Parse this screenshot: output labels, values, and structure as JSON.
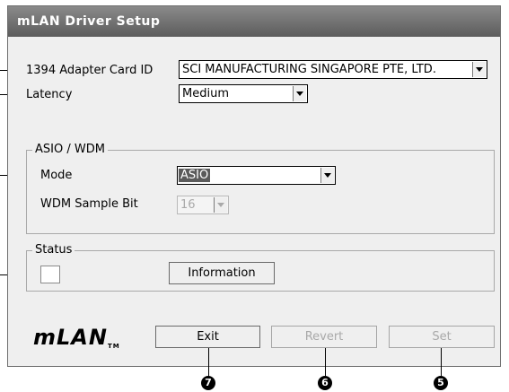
{
  "window": {
    "title": "mLAN Driver Setup"
  },
  "adapter": {
    "label": "1394 Adapter Card ID",
    "value": "SCI MANUFACTURING SINGAPORE PTE, LTD."
  },
  "latency": {
    "label": "Latency",
    "value": "Medium"
  },
  "asio_group": {
    "title": "ASIO / WDM",
    "mode_label": "Mode",
    "mode_value": "ASIO",
    "wdm_label": "WDM Sample Bit",
    "wdm_value": "16"
  },
  "status_group": {
    "title": "Status",
    "information_label": "Information"
  },
  "logo": {
    "text": "mLAN",
    "tm": "TM"
  },
  "buttons": {
    "exit": "Exit",
    "revert": "Revert",
    "set": "Set"
  },
  "callouts": {
    "set": "5",
    "revert": "6",
    "exit": "7"
  }
}
